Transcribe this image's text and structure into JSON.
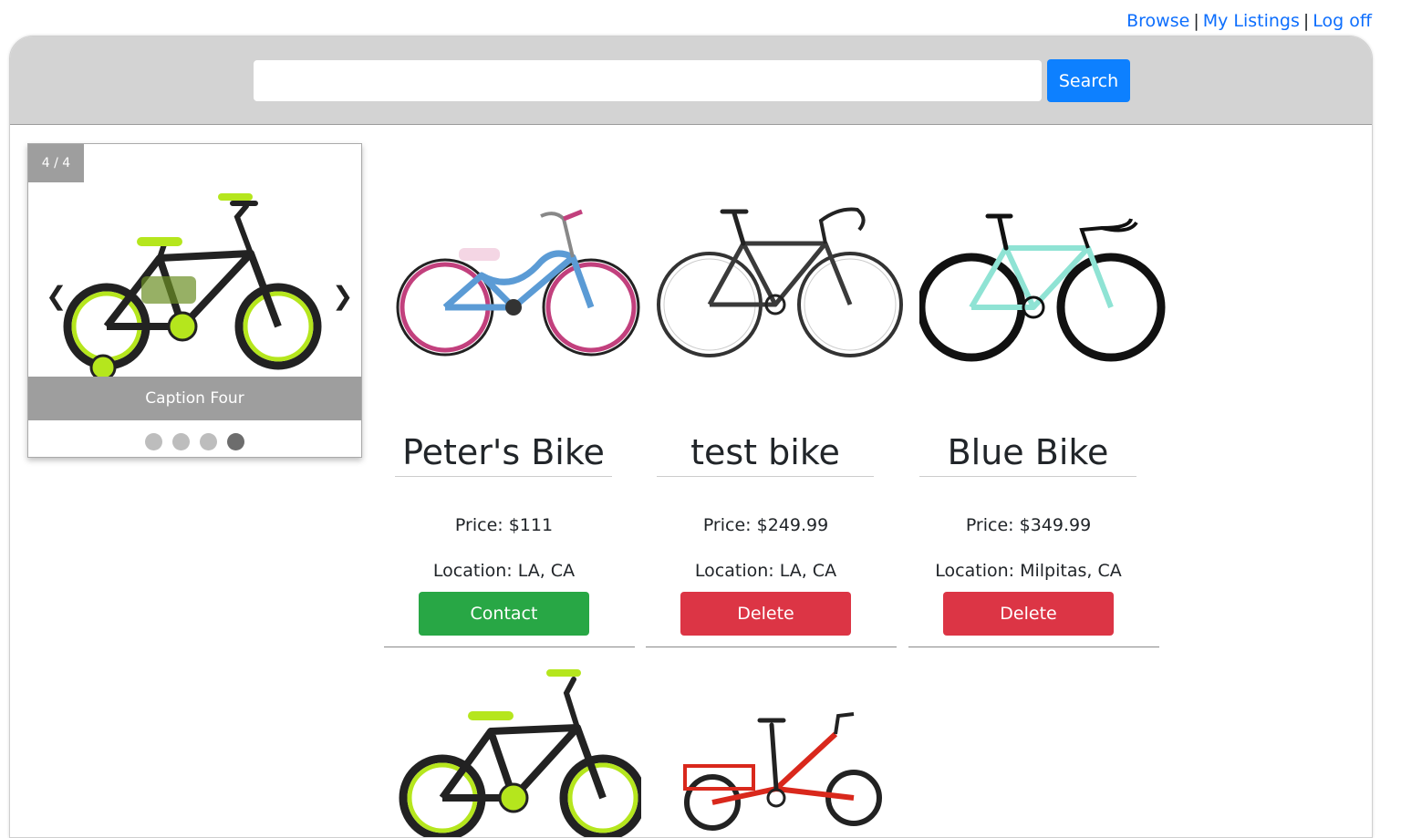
{
  "nav": {
    "browse": "Browse",
    "my_listings": "My Listings",
    "log_off": "Log off",
    "separator": "|"
  },
  "search": {
    "value": "",
    "placeholder": "",
    "button_label": "Search"
  },
  "carousel": {
    "counter": "4 / 4",
    "caption": "Caption Four",
    "prev": "❮",
    "next": "❯",
    "dot_count": 4,
    "active_index": 3
  },
  "listings": [
    {
      "name": "Peter's Bike",
      "price": "Price: $111",
      "location": "Location: LA, CA",
      "action": "Contact",
      "action_color": "#28a745"
    },
    {
      "name": "test bike",
      "price": "Price: $249.99",
      "location": "Location: LA, CA",
      "action": "Delete",
      "action_color": "#dc3545"
    },
    {
      "name": "Blue Bike",
      "price": "Price: $349.99",
      "location": "Location: Milpitas, CA",
      "action": "Delete",
      "action_color": "#dc3545"
    }
  ],
  "colors": {
    "link": "#0d6efd",
    "search_button": "#0d80ff",
    "contact": "#28a745",
    "delete": "#dc3545",
    "header_bg": "#d3d3d3"
  }
}
